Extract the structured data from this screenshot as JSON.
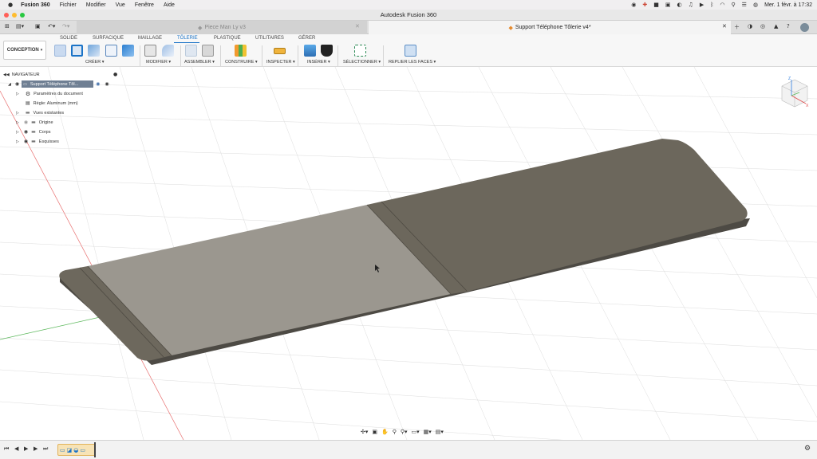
{
  "menubar": {
    "apple": "",
    "app": "Fusion 360",
    "items": [
      "Fichier",
      "Modifier",
      "Vue",
      "Fenêtre",
      "Aide"
    ],
    "clock": "Mer. 1 févr. à 17:32"
  },
  "window": {
    "title": "Autodesk Fusion 360"
  },
  "tabs": [
    {
      "label": "Piece Man Ly v3",
      "active": false
    },
    {
      "label": "Support Téléphone Tôlerie v4*",
      "active": true
    }
  ],
  "workspace": {
    "mode": "CONCEPTION",
    "tabs": [
      "SOLIDE",
      "SURFACIQUE",
      "MAILLAGE",
      "TÔLERIE",
      "PLASTIQUE",
      "UTILITAIRES",
      "GÉRER"
    ],
    "active_tab": "TÔLERIE",
    "groups": [
      "CRÉER",
      "MODIFIER",
      "ASSEMBLER",
      "CONSTRUIRE",
      "INSPECTER",
      "INSÉRER",
      "SÉLECTIONNER",
      "REPLIER LES FACES"
    ]
  },
  "navigator": {
    "title": "NAVIGATEUR",
    "root": "Support Téléphone Tôl...",
    "items": [
      {
        "label": "Paramètres du document",
        "icon": "gear-icon"
      },
      {
        "label": "Règle: Aluminum (mm)",
        "icon": "sheet-rule-icon"
      },
      {
        "label": "Vues existantes",
        "icon": "folder-icon"
      },
      {
        "label": "Origine",
        "icon": "folder-icon"
      },
      {
        "label": "Corps",
        "icon": "folder-icon"
      },
      {
        "label": "Esquisses",
        "icon": "folder-icon"
      }
    ]
  },
  "viewcube": {
    "z": "Z",
    "x": "X"
  },
  "colors": {
    "accent": "#1a73c7",
    "part_light": "#9e9a91",
    "part_dark": "#6b665b"
  }
}
